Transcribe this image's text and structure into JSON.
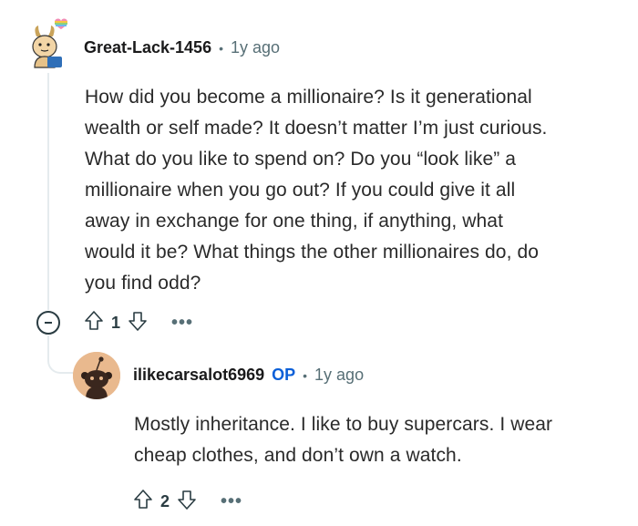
{
  "comment": {
    "username": "Great-Lack-1456",
    "separator": "•",
    "age": "1y ago",
    "body_lines": [
      "How did you become a millionaire? Is it generational",
      "wealth or self made? It doesn’t matter I’m just curious.",
      "What do you like to spend on? Do you “look like” a",
      "millionaire when you go out? If you could give it all",
      "away in exchange for one thing, if anything, what",
      "would it be? What things the other millionaires do, do",
      "you find odd?"
    ],
    "votes": "1",
    "more": "•••"
  },
  "reply": {
    "username": "ilikecarsalot6969",
    "op_badge": "OP",
    "separator": "•",
    "age": "1y ago",
    "body_lines": [
      "Mostly inheritance. I like to buy supercars. I wear",
      "cheap clothes, and don’t own a watch."
    ],
    "votes": "2",
    "more": "•••"
  },
  "icons": {
    "collapse": "collapse-icon",
    "upvote": "upvote-arrow-icon",
    "downvote": "downvote-arrow-icon",
    "more": "more-options-icon"
  }
}
